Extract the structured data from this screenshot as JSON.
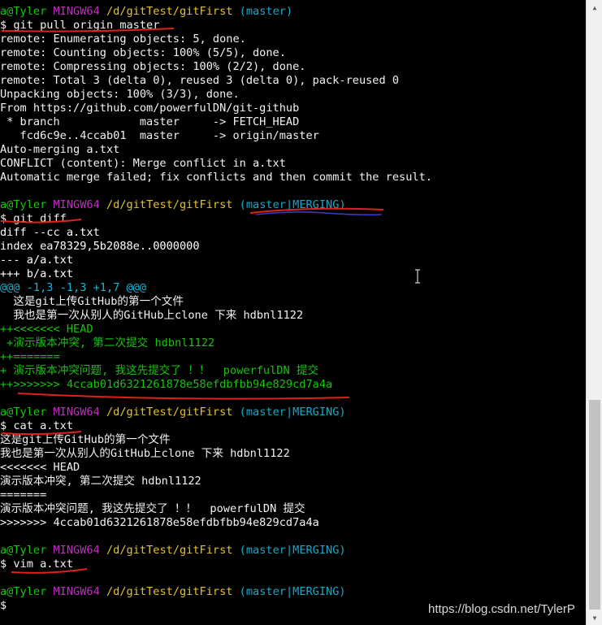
{
  "colors": {
    "prompt_user": "#16c60c",
    "prompt_mingw": "#bf2fbf",
    "prompt_path": "#e5c02a",
    "prompt_branch": "#19a7c8",
    "output": "#eaeaea",
    "diff_hunk": "#16b5d6",
    "diff_add": "#17c40c",
    "annotation_red": "#e0201c",
    "annotation_blue": "#2f3fd0",
    "background": "#000000"
  },
  "terminal": {
    "lines": [
      [
        {
          "t": "a@Tyler ",
          "c": "green"
        },
        {
          "t": "MINGW64 ",
          "c": "magenta"
        },
        {
          "t": "/d/gitTest/gitFirst ",
          "c": "yellow"
        },
        {
          "t": "(master)",
          "c": "cyan"
        }
      ],
      [
        {
          "t": "$ git pull origin master",
          "c": "white"
        }
      ],
      [
        {
          "t": "remote: Enumerating objects: 5, done.",
          "c": "white"
        }
      ],
      [
        {
          "t": "remote: Counting objects: 100% (5/5), done.",
          "c": "white"
        }
      ],
      [
        {
          "t": "remote: Compressing objects: 100% (2/2), done.",
          "c": "white"
        }
      ],
      [
        {
          "t": "remote: Total 3 (delta 0), reused 3 (delta 0), pack-reused 0",
          "c": "white"
        }
      ],
      [
        {
          "t": "Unpacking objects: 100% (3/3), done.",
          "c": "white"
        }
      ],
      [
        {
          "t": "From https://github.com/powerfulDN/git-github",
          "c": "white"
        }
      ],
      [
        {
          "t": " * branch            master     -> FETCH_HEAD",
          "c": "white"
        }
      ],
      [
        {
          "t": "   fcd6c9e..4ccab01  master     -> origin/master",
          "c": "white"
        }
      ],
      [
        {
          "t": "Auto-merging a.txt",
          "c": "white"
        }
      ],
      [
        {
          "t": "CONFLICT (content): Merge conflict in a.txt",
          "c": "white"
        }
      ],
      [
        {
          "t": "Automatic merge failed; fix conflicts and then commit the result.",
          "c": "white"
        }
      ],
      [],
      [
        {
          "t": "a@Tyler ",
          "c": "green"
        },
        {
          "t": "MINGW64 ",
          "c": "magenta"
        },
        {
          "t": "/d/gitTest/gitFirst ",
          "c": "yellow"
        },
        {
          "t": "(master|MERGING)",
          "c": "cyan"
        }
      ],
      [
        {
          "t": "$ git diff",
          "c": "white"
        }
      ],
      [
        {
          "t": "diff --cc a.txt",
          "c": "bold"
        }
      ],
      [
        {
          "t": "index ea78329,5b2088e..0000000",
          "c": "bold"
        }
      ],
      [
        {
          "t": "--- a/a.txt",
          "c": "bold"
        }
      ],
      [
        {
          "t": "+++ b/a.txt",
          "c": "bold"
        }
      ],
      [
        {
          "t": "@@@ -1,3 -1,3 +1,7 @@@",
          "c": "hunk"
        }
      ],
      [
        {
          "t": "  这是git上传GitHub的第一个文件",
          "c": "white"
        }
      ],
      [
        {
          "t": "  我也是第一次从别人的GitHub上clone 下来 hdbnl1122",
          "c": "white"
        }
      ],
      [
        {
          "t": "++<<<<<<< HEAD",
          "c": "diffadd"
        }
      ],
      [
        {
          "t": " +演示版本冲突, 第二次提交 hdbnl1122",
          "c": "diffadd"
        }
      ],
      [
        {
          "t": "++=======",
          "c": "diffadd"
        }
      ],
      [
        {
          "t": "+ 演示版本冲突问题, 我这先提交了 ！！  powerfulDN 提交",
          "c": "diffadd"
        }
      ],
      [
        {
          "t": "++>>>>>>> 4ccab01d6321261878e58efdbfbb94e829cd7a4a",
          "c": "diffadd"
        }
      ],
      [],
      [
        {
          "t": "a@Tyler ",
          "c": "green"
        },
        {
          "t": "MINGW64 ",
          "c": "magenta"
        },
        {
          "t": "/d/gitTest/gitFirst ",
          "c": "yellow"
        },
        {
          "t": "(master|MERGING)",
          "c": "cyan"
        }
      ],
      [
        {
          "t": "$ cat a.txt",
          "c": "white"
        }
      ],
      [
        {
          "t": "这是git上传GitHub的第一个文件",
          "c": "white"
        }
      ],
      [
        {
          "t": "我也是第一次从别人的GitHub上clone 下来 hdbnl1122",
          "c": "white"
        }
      ],
      [
        {
          "t": "<<<<<<< HEAD",
          "c": "white"
        }
      ],
      [
        {
          "t": "演示版本冲突, 第二次提交 hdbnl1122",
          "c": "white"
        }
      ],
      [
        {
          "t": "=======",
          "c": "white"
        }
      ],
      [
        {
          "t": "演示版本冲突问题, 我这先提交了 ！！  powerfulDN 提交",
          "c": "white"
        }
      ],
      [
        {
          "t": ">>>>>>> 4ccab01d6321261878e58efdbfbb94e829cd7a4a",
          "c": "white"
        }
      ],
      [],
      [
        {
          "t": "a@Tyler ",
          "c": "green"
        },
        {
          "t": "MINGW64 ",
          "c": "magenta"
        },
        {
          "t": "/d/gitTest/gitFirst ",
          "c": "yellow"
        },
        {
          "t": "(master|MERGING)",
          "c": "cyan"
        }
      ],
      [
        {
          "t": "$ vim a.txt",
          "c": "white"
        }
      ],
      [],
      [
        {
          "t": "a@Tyler ",
          "c": "green"
        },
        {
          "t": "MINGW64 ",
          "c": "magenta"
        },
        {
          "t": "/d/gitTest/gitFirst ",
          "c": "yellow"
        },
        {
          "t": "(master|MERGING)",
          "c": "cyan"
        }
      ],
      [
        {
          "t": "$",
          "c": "white"
        }
      ]
    ]
  },
  "scrollbar": {
    "up_icon": "arrow-up-icon",
    "down_icon": "arrow-down-icon",
    "scroll_position": 0.64
  },
  "watermark": "https://blog.csdn.net/TylerP"
}
